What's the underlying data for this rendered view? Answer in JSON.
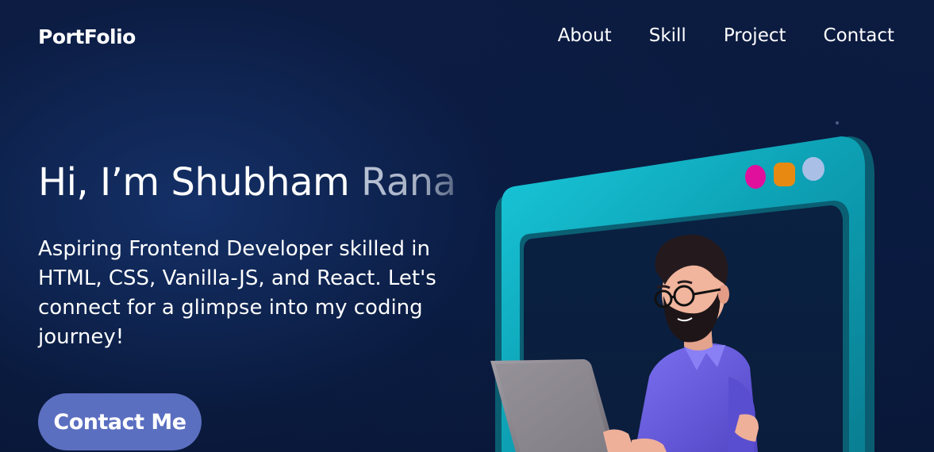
{
  "header": {
    "logo": "PortFolio",
    "nav": [
      {
        "label": "About"
      },
      {
        "label": "Skill"
      },
      {
        "label": "Project"
      },
      {
        "label": "Contact"
      }
    ]
  },
  "hero": {
    "title_main": "Hi, I’m Shubham ",
    "title_fade": "Rana",
    "description": "Aspiring Frontend Developer skilled in HTML, CSS, Vanilla-JS, and React. Let's connect for a glimpse into my coding journey!",
    "cta_label": "Contact Me"
  },
  "colors": {
    "background": "#0b1a3e",
    "button": "#5b6fc0",
    "frame_teal": "#0fb4c6",
    "dot_pink": "#e0109c",
    "dot_orange": "#e88a12",
    "dot_blue": "#a9bfe6",
    "shirt": "#6b5fe0"
  },
  "illustration": {
    "subject": "developer-avatar-with-laptop",
    "window_dots": [
      "pink",
      "orange",
      "light-blue"
    ]
  }
}
